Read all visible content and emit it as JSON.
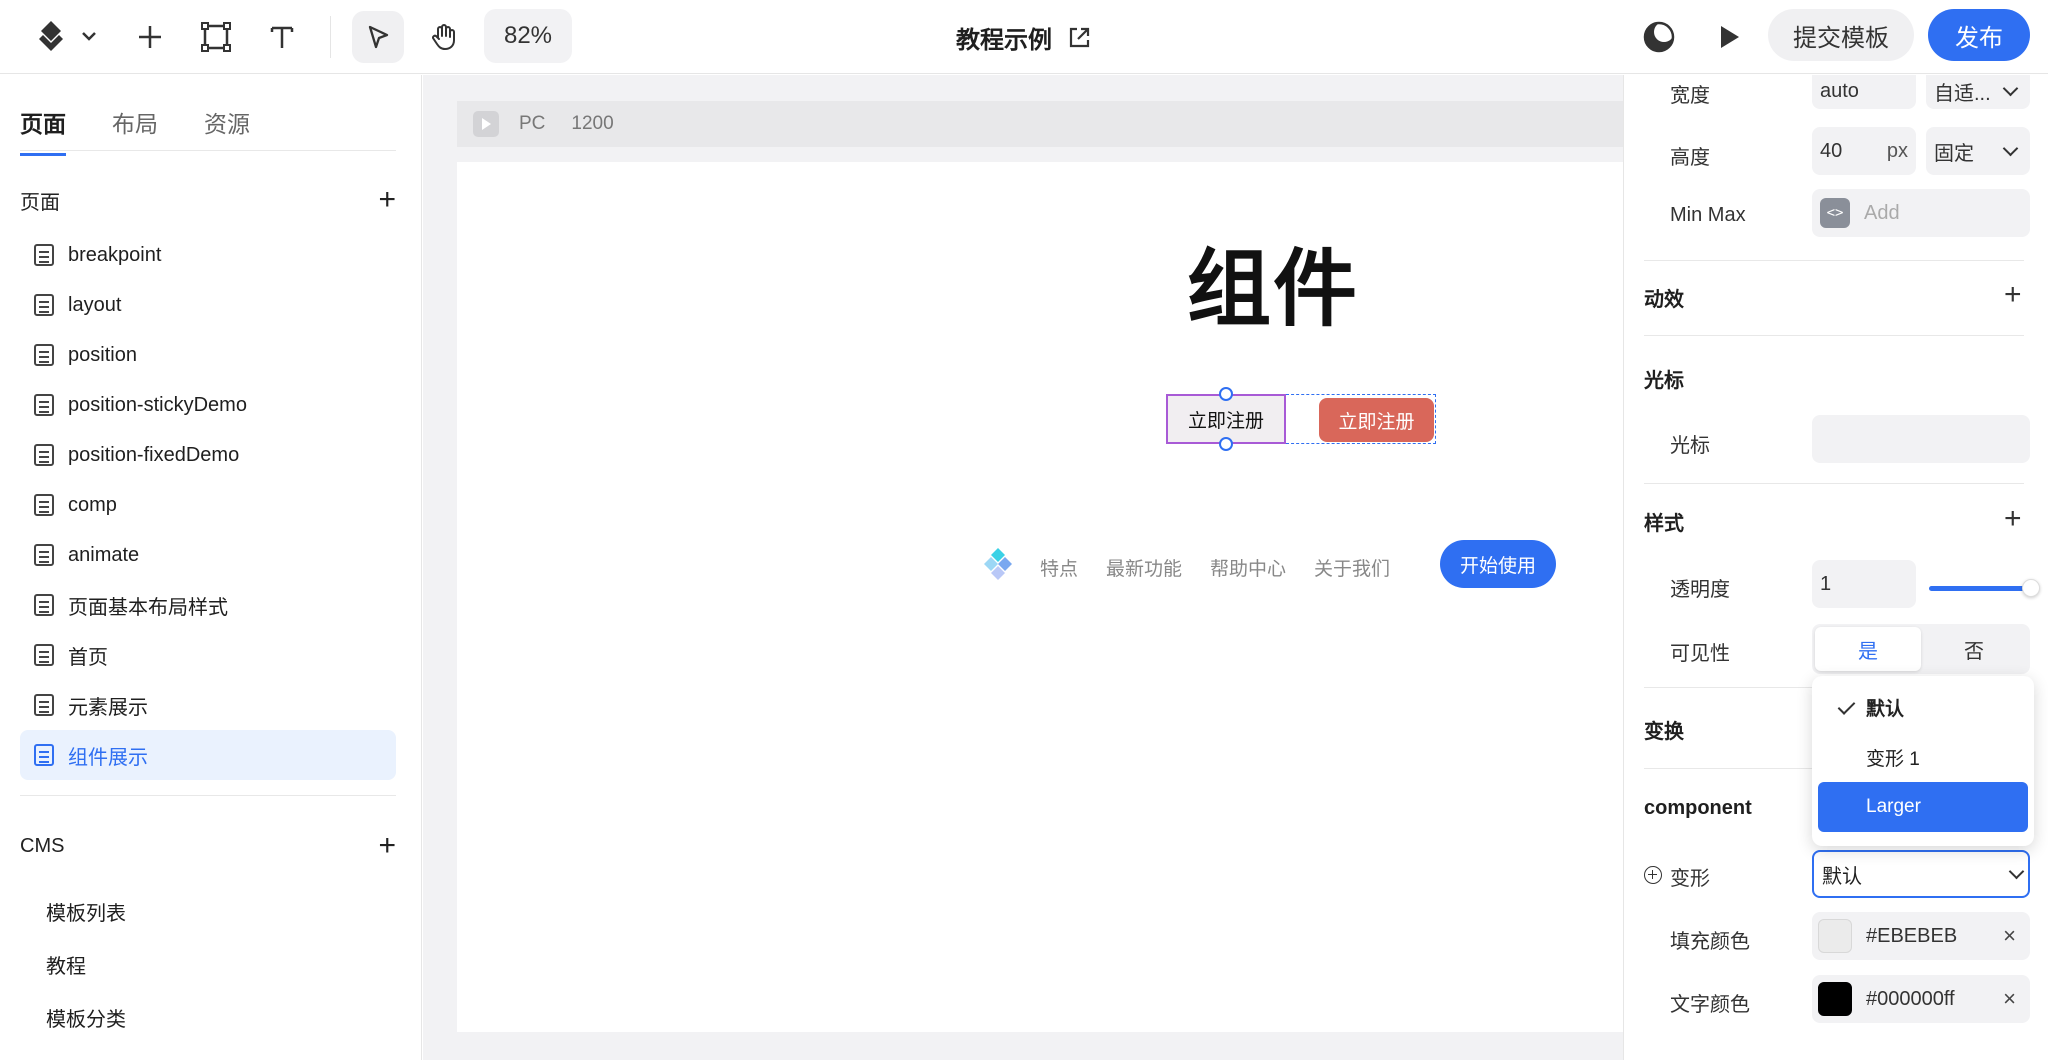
{
  "toolbar": {
    "zoom": "82%",
    "doc_title": "教程示例",
    "submit_label": "提交模板",
    "publish_label": "发布",
    "brand_color": "#2f6ff2"
  },
  "left_panel": {
    "tabs": [
      "页面",
      "布局",
      "资源"
    ],
    "pages_section_title": "页面",
    "pages": [
      "breakpoint",
      "layout",
      "position",
      "position-stickyDemo",
      "position-fixedDemo",
      "comp",
      "animate",
      "页面基本布局样式",
      "首页",
      "元素展示",
      "组件展示"
    ],
    "selected_page": "组件展示",
    "cms_section_title": "CMS",
    "cms_items": [
      "模板列表",
      "教程",
      "模板分类"
    ]
  },
  "canvas": {
    "breakpoint_label": "PC",
    "breakpoint_width": "1200",
    "hero_title": "组件",
    "button_default_label": "立即注册",
    "button_larger_label": "立即注册",
    "nav_links": [
      "特点",
      "最新功能",
      "帮助中心",
      "关于我们"
    ],
    "cta_label": "开始使用"
  },
  "right_panel": {
    "width_label": "宽度",
    "width_value": "auto",
    "width_mode": "自适...",
    "height_label": "高度",
    "height_value": "40",
    "height_unit": "px",
    "height_mode": "固定",
    "minmax_label": "Min Max",
    "minmax_placeholder": "Add",
    "animation_title": "动效",
    "cursor_title": "光标",
    "cursor_label": "光标",
    "style_title": "样式",
    "opacity_label": "透明度",
    "opacity_value": "1",
    "opacity_level": 1,
    "visibility_label": "可见性",
    "visibility_yes": "是",
    "visibility_no": "否",
    "transform_title": "变换",
    "component_title": "component",
    "variant_label": "变形",
    "variant_value": "默认",
    "variant_options": [
      "默认",
      "变形 1",
      "Larger"
    ],
    "variant_checked": "默认",
    "variant_highlighted": "Larger",
    "fill_label": "填充颜色",
    "fill_value": "#EBEBEB",
    "text_color_label": "文字颜色",
    "text_color_value": "#000000ff"
  },
  "icons": {
    "logo": "diamond-logo-icon",
    "chevron": "chevron-down-icon",
    "add": "plus-icon",
    "frame": "frame-tool-icon",
    "text": "text-tool-icon",
    "pointer": "pointer-tool-icon",
    "hand": "hand-tool-icon",
    "external": "external-link-icon",
    "theme": "dark-mode-icon",
    "play": "play-icon",
    "page": "page-icon",
    "close": "close-icon"
  }
}
